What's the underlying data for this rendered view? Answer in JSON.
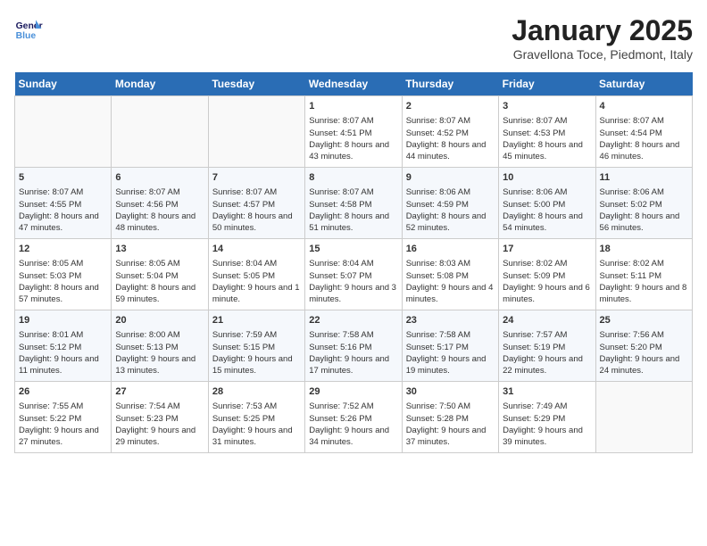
{
  "header": {
    "logo_line1": "General",
    "logo_line2": "Blue",
    "month_title": "January 2025",
    "location": "Gravellona Toce, Piedmont, Italy"
  },
  "days_of_week": [
    "Sunday",
    "Monday",
    "Tuesday",
    "Wednesday",
    "Thursday",
    "Friday",
    "Saturday"
  ],
  "weeks": [
    [
      {
        "day": "",
        "empty": true
      },
      {
        "day": "",
        "empty": true
      },
      {
        "day": "",
        "empty": true
      },
      {
        "day": "1",
        "sunrise": "8:07 AM",
        "sunset": "4:51 PM",
        "daylight": "8 hours and 43 minutes."
      },
      {
        "day": "2",
        "sunrise": "8:07 AM",
        "sunset": "4:52 PM",
        "daylight": "8 hours and 44 minutes."
      },
      {
        "day": "3",
        "sunrise": "8:07 AM",
        "sunset": "4:53 PM",
        "daylight": "8 hours and 45 minutes."
      },
      {
        "day": "4",
        "sunrise": "8:07 AM",
        "sunset": "4:54 PM",
        "daylight": "8 hours and 46 minutes."
      }
    ],
    [
      {
        "day": "5",
        "sunrise": "8:07 AM",
        "sunset": "4:55 PM",
        "daylight": "8 hours and 47 minutes."
      },
      {
        "day": "6",
        "sunrise": "8:07 AM",
        "sunset": "4:56 PM",
        "daylight": "8 hours and 48 minutes."
      },
      {
        "day": "7",
        "sunrise": "8:07 AM",
        "sunset": "4:57 PM",
        "daylight": "8 hours and 50 minutes."
      },
      {
        "day": "8",
        "sunrise": "8:07 AM",
        "sunset": "4:58 PM",
        "daylight": "8 hours and 51 minutes."
      },
      {
        "day": "9",
        "sunrise": "8:06 AM",
        "sunset": "4:59 PM",
        "daylight": "8 hours and 52 minutes."
      },
      {
        "day": "10",
        "sunrise": "8:06 AM",
        "sunset": "5:00 PM",
        "daylight": "8 hours and 54 minutes."
      },
      {
        "day": "11",
        "sunrise": "8:06 AM",
        "sunset": "5:02 PM",
        "daylight": "8 hours and 56 minutes."
      }
    ],
    [
      {
        "day": "12",
        "sunrise": "8:05 AM",
        "sunset": "5:03 PM",
        "daylight": "8 hours and 57 minutes."
      },
      {
        "day": "13",
        "sunrise": "8:05 AM",
        "sunset": "5:04 PM",
        "daylight": "8 hours and 59 minutes."
      },
      {
        "day": "14",
        "sunrise": "8:04 AM",
        "sunset": "5:05 PM",
        "daylight": "9 hours and 1 minute."
      },
      {
        "day": "15",
        "sunrise": "8:04 AM",
        "sunset": "5:07 PM",
        "daylight": "9 hours and 3 minutes."
      },
      {
        "day": "16",
        "sunrise": "8:03 AM",
        "sunset": "5:08 PM",
        "daylight": "9 hours and 4 minutes."
      },
      {
        "day": "17",
        "sunrise": "8:02 AM",
        "sunset": "5:09 PM",
        "daylight": "9 hours and 6 minutes."
      },
      {
        "day": "18",
        "sunrise": "8:02 AM",
        "sunset": "5:11 PM",
        "daylight": "9 hours and 8 minutes."
      }
    ],
    [
      {
        "day": "19",
        "sunrise": "8:01 AM",
        "sunset": "5:12 PM",
        "daylight": "9 hours and 11 minutes."
      },
      {
        "day": "20",
        "sunrise": "8:00 AM",
        "sunset": "5:13 PM",
        "daylight": "9 hours and 13 minutes."
      },
      {
        "day": "21",
        "sunrise": "7:59 AM",
        "sunset": "5:15 PM",
        "daylight": "9 hours and 15 minutes."
      },
      {
        "day": "22",
        "sunrise": "7:58 AM",
        "sunset": "5:16 PM",
        "daylight": "9 hours and 17 minutes."
      },
      {
        "day": "23",
        "sunrise": "7:58 AM",
        "sunset": "5:17 PM",
        "daylight": "9 hours and 19 minutes."
      },
      {
        "day": "24",
        "sunrise": "7:57 AM",
        "sunset": "5:19 PM",
        "daylight": "9 hours and 22 minutes."
      },
      {
        "day": "25",
        "sunrise": "7:56 AM",
        "sunset": "5:20 PM",
        "daylight": "9 hours and 24 minutes."
      }
    ],
    [
      {
        "day": "26",
        "sunrise": "7:55 AM",
        "sunset": "5:22 PM",
        "daylight": "9 hours and 27 minutes."
      },
      {
        "day": "27",
        "sunrise": "7:54 AM",
        "sunset": "5:23 PM",
        "daylight": "9 hours and 29 minutes."
      },
      {
        "day": "28",
        "sunrise": "7:53 AM",
        "sunset": "5:25 PM",
        "daylight": "9 hours and 31 minutes."
      },
      {
        "day": "29",
        "sunrise": "7:52 AM",
        "sunset": "5:26 PM",
        "daylight": "9 hours and 34 minutes."
      },
      {
        "day": "30",
        "sunrise": "7:50 AM",
        "sunset": "5:28 PM",
        "daylight": "9 hours and 37 minutes."
      },
      {
        "day": "31",
        "sunrise": "7:49 AM",
        "sunset": "5:29 PM",
        "daylight": "9 hours and 39 minutes."
      },
      {
        "day": "",
        "empty": true
      }
    ]
  ],
  "labels": {
    "sunrise_label": "Sunrise:",
    "sunset_label": "Sunset:",
    "daylight_label": "Daylight:"
  }
}
